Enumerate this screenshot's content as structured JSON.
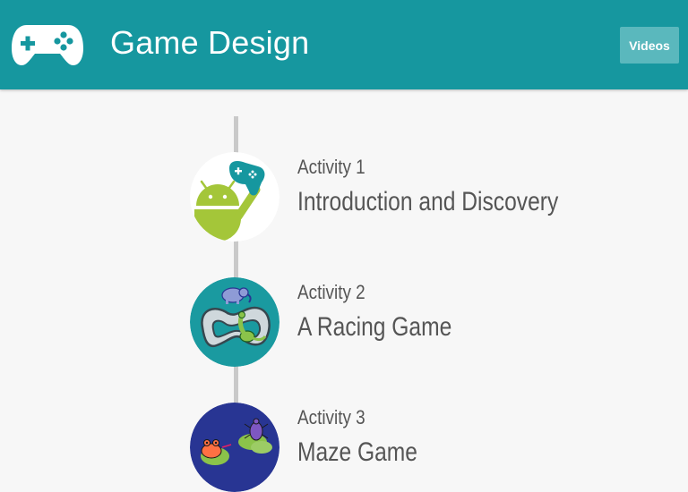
{
  "header": {
    "title": "Game Design",
    "logo_icon": "gamepad-icon",
    "videos_label": "Videos",
    "bg_color": "#16979f"
  },
  "activities": [
    {
      "label": "Activity 1",
      "title": "Introduction and Discovery",
      "icon": "android-gamepad-icon"
    },
    {
      "label": "Activity 2",
      "title": "A Racing Game",
      "icon": "racetrack-elephant-dinosaur-icon"
    },
    {
      "label": "Activity 3",
      "title": "Maze Game",
      "icon": "pond-frog-beetle-icon"
    }
  ]
}
